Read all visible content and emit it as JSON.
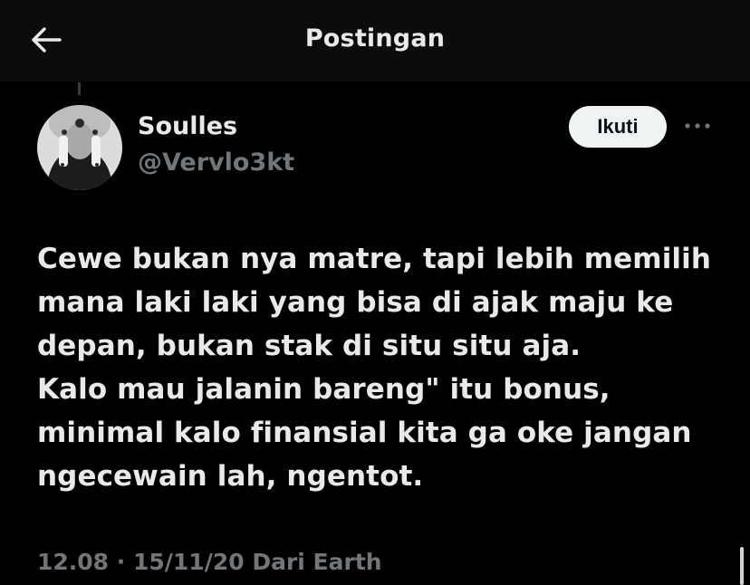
{
  "header": {
    "title": "Postingan",
    "back_icon": "arrow-left-icon"
  },
  "post": {
    "author": {
      "display_name": "Soulles",
      "handle": "@Vervlo3kt"
    },
    "follow_label": "Ikuti",
    "more_icon": "more-horizontal-icon",
    "text": "Cewe bukan nya matre, tapi lebih memilih\nmana laki laki yang bisa di ajak maju ke\ndepan, bukan stak di situ situ aja.\nKalo mau jalanin bareng\" itu bonus,\nminimal kalo finansial kita ga oke jangan\nngecewain lah, ngentot.",
    "meta": "12.08 · 15/11/20 Dari Earth"
  },
  "colors": {
    "background": "#000000",
    "topbar": "#0c0c0c",
    "primary_text": "#e7e9ea",
    "secondary_text": "#71767b",
    "follow_button_bg": "#eff3f4"
  }
}
